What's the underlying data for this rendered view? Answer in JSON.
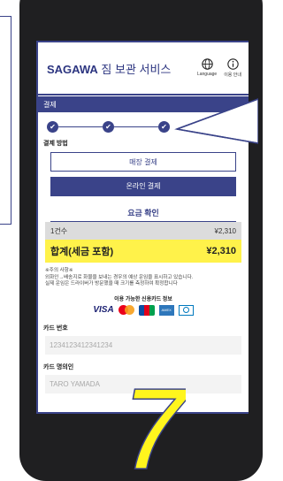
{
  "app": {
    "brand_bold": "SAGAWA",
    "brand_rest": " 짐 보관 서비스",
    "language_label": "Language",
    "guide_label": "이용 안내",
    "page_title": "결제"
  },
  "progress": {
    "steps": [
      "✔",
      "✔",
      "✔"
    ]
  },
  "payment": {
    "section_label": "결제 방법",
    "in_store_label": "매장 결제",
    "online_label": "온라인 결제"
  },
  "fees": {
    "title": "요금 확인",
    "count_label": "1건수",
    "count_amount": "¥2,310",
    "total_label": "합계(세금 포함)",
    "total_amount": "¥2,310"
  },
  "notes": [
    "※주의 사항※",
    "외화인→배송지로 화물을 보내는 경우의 예상 운임을 표시하고 있습니다.",
    "실제 운임은 드라이버가 방문했을 때 크기를 측정하여 확정합니다"
  ],
  "cards": {
    "title": "이용 가능한 신용카드 정보",
    "visa": "VISA",
    "amex": "AMEX"
  },
  "form": {
    "card_number_label": "카드 번호",
    "card_number_placeholder": "1234123412341234",
    "card_holder_label": "카드 명의인",
    "card_holder_placeholder": "TARO YAMADA"
  },
  "overlay": {
    "step_number": "7"
  },
  "colors": {
    "brand_navy": "#3a4389",
    "total_highlight": "#fff24a",
    "phone_body": "#1f1f21"
  }
}
